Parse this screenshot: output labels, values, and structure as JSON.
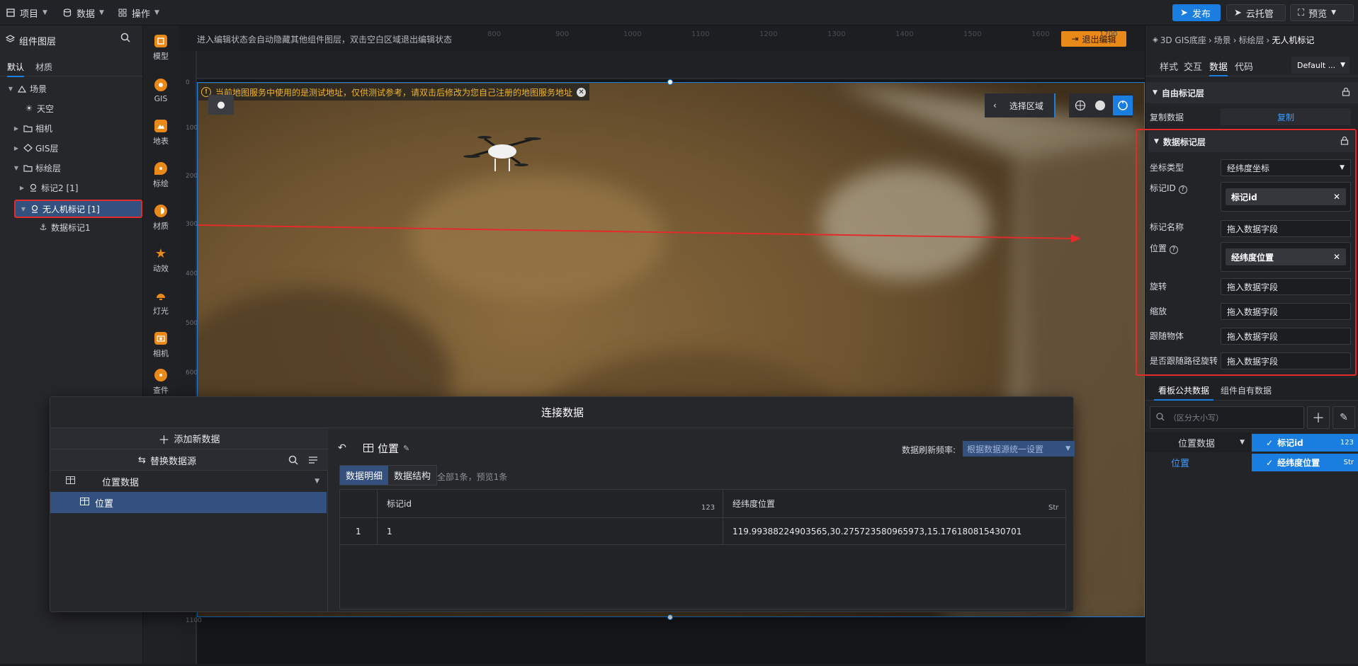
{
  "topbar": {
    "menus": [
      {
        "label": "项目"
      },
      {
        "label": "数据"
      },
      {
        "label": "操作"
      }
    ],
    "publish_label": "发布",
    "cloud_label": "云托管",
    "preview_label": "预览"
  },
  "left_panel": {
    "title": "组件图层",
    "tabs": [
      "默认",
      "材质"
    ],
    "tree": [
      {
        "label": "场景",
        "icon": "scene-icon"
      },
      {
        "label": "天空",
        "icon": "sky-icon"
      },
      {
        "label": "相机",
        "icon": "folder-icon"
      },
      {
        "label": "GIS层",
        "icon": "gis-icon"
      },
      {
        "label": "标绘层",
        "icon": "folder-icon"
      },
      {
        "label": "标记2 [1]",
        "icon": "marker-icon"
      },
      {
        "label": "无人机标记 [1]",
        "icon": "marker-icon"
      },
      {
        "label": "数据标记1",
        "icon": "anchor-icon"
      }
    ]
  },
  "icon_bar": [
    {
      "label": "模型",
      "icon": "model-icon"
    },
    {
      "label": "GIS",
      "icon": "gis-icon"
    },
    {
      "label": "地表",
      "icon": "terrain-icon"
    },
    {
      "label": "标绘",
      "icon": "pin-icon"
    },
    {
      "label": "材质",
      "icon": "material-icon"
    },
    {
      "label": "动效",
      "icon": "effect-icon"
    },
    {
      "label": "灯光",
      "icon": "light-icon"
    },
    {
      "label": "相机",
      "icon": "camera-icon"
    },
    {
      "label": "查件",
      "icon": "gear-icon"
    }
  ],
  "canvas": {
    "notice": "进入编辑状态会自动隐藏其他组件图层，双击空白区域退出编辑状态",
    "exit_edit_label": "退出编辑",
    "warning": "当前地图服务中使用的是测试地址，仅供测试参考，请双击后修改为您自己注册的地图服务地址",
    "select_area_label": "选择区域",
    "ruler_top_ticks": [
      "800",
      "900",
      "1000",
      "1100",
      "1200",
      "1300",
      "1400",
      "1500",
      "1600",
      "1700"
    ],
    "ruler_left_ticks": [
      "0",
      "100",
      "200",
      "300",
      "400",
      "500",
      "600",
      "1100"
    ]
  },
  "connect_dialog": {
    "title": "连接数据",
    "add_source_label": "添加新数据",
    "replace_source_label": "替换数据源",
    "dataset_group": "位置数据",
    "dataset_item": "位置",
    "panel_title": "位置",
    "refresh_label": "数据刷新频率:",
    "refresh_value": "根据数据源统一设置",
    "tabs": [
      "数据明细",
      "数据结构"
    ],
    "summary": "全部1条，预览1条",
    "columns": [
      {
        "name": "标记id",
        "type": "123"
      },
      {
        "name": "经纬度位置",
        "type": "Str"
      }
    ],
    "rows": [
      {
        "index": "1",
        "id": "1",
        "position": "119.99388224903565,30.275723580965973,15.176180815430701"
      }
    ]
  },
  "right_panel": {
    "breadcrumb": [
      "3D GIS底座",
      "场景",
      "标绘层",
      "无人机标记"
    ],
    "tabs": [
      "样式",
      "交互",
      "数据",
      "代码"
    ],
    "active_tab": "数据",
    "default_select": "Default ...",
    "free_layer_title": "自由标记层",
    "copy_data_label": "复制数据",
    "copy_button": "复制",
    "data_layer_title": "数据标记层",
    "fields": {
      "coord_type_label": "坐标类型",
      "coord_type_value": "经纬度坐标",
      "id_label": "标记ID",
      "id_value": "标记id",
      "name_label": "标记名称",
      "name_placeholder": "拖入数据字段",
      "position_label": "位置",
      "position_value": "经纬度位置",
      "rotation_label": "旋转",
      "rotation_placeholder": "拖入数据字段",
      "scale_label": "缩放",
      "scale_placeholder": "拖入数据字段",
      "follow_label": "跟随物体",
      "follow_placeholder": "拖入数据字段",
      "path_rotate_label": "是否跟随路径旋转",
      "path_rotate_placeholder": "拖入数据字段"
    },
    "bottom_tabs": [
      "看板公共数据",
      "组件自有数据"
    ],
    "search_placeholder": "（区分大小写）",
    "dataset_label": "位置数据",
    "dataset_item": "位置",
    "field_chips": [
      {
        "name": "标记id",
        "type": "123"
      },
      {
        "name": "经纬度位置",
        "type": "Str"
      }
    ]
  },
  "colors": {
    "accent": "#1a7ee0",
    "highlight": "#e22b2b",
    "warning": "#f0b429",
    "orange": "#e8891a"
  }
}
